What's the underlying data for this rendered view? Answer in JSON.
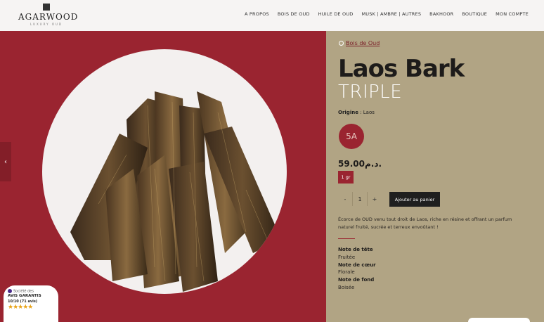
{
  "brand": {
    "name": "AGARWOOD",
    "tagline": "LUXURY OUD"
  },
  "nav": {
    "items": [
      "A PROPOS",
      "BOIS DE OUD",
      "HUILE DE OUD",
      "MUSK | AMBRE | AUTRES",
      "BAKHOOR",
      "BOUTIQUE",
      "MON COMPTE"
    ]
  },
  "product": {
    "breadcrumb": "Bois de Oud",
    "title": "Laos Bark",
    "subtitle": "TRIPLE",
    "origin_label": "Origine",
    "origin_value": "Laos",
    "grade": "5A",
    "price": "59.00د.م.",
    "variant": "1 gr",
    "quantity": "1",
    "qty_minus": "-",
    "qty_plus": "+",
    "add_to_cart": "Ajouter au panier",
    "description": "Écorce de OUD venu tout droit de Laos, riche en résine et offrant un parfum naturel fruité, sucrée et terreux envoûtant !",
    "notes": [
      {
        "label": "Note de tête",
        "value": "Fruitée"
      },
      {
        "label": "Note de cœur",
        "value": "Florale"
      },
      {
        "label": "Note de fond",
        "value": "Boisée"
      }
    ]
  },
  "badge": {
    "label": "Société des",
    "title": "AVIS GARANTIS",
    "score": "10/10 (71 avis)",
    "stars": "★★★★★"
  },
  "arrows": {
    "prev": "‹",
    "next": "›"
  },
  "colors": {
    "hero_bg": "#9a2430",
    "panel_bg": "#b1a484",
    "accent": "#9a2430",
    "button_dark": "#1f1f1f"
  }
}
